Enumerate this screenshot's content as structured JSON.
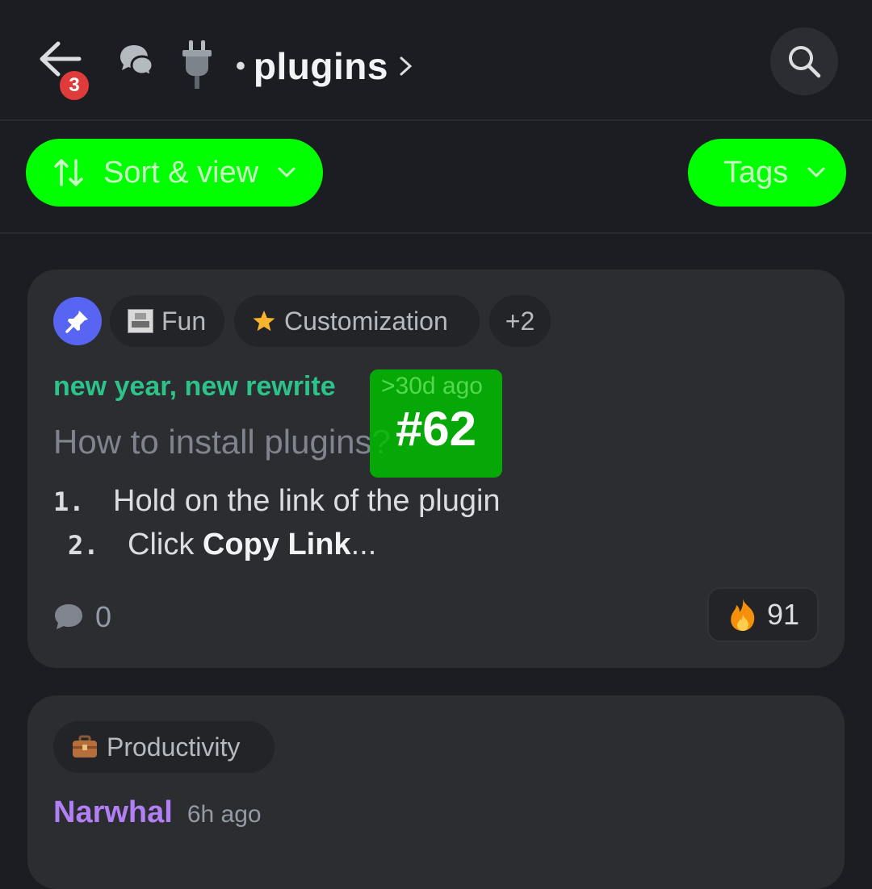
{
  "header": {
    "back_badge_count": "3",
    "channel_separator": "•",
    "channel_name": "plugins",
    "icons": [
      "back-arrow-icon",
      "threads-icon",
      "plug-icon",
      "chevron-right-icon",
      "search-icon"
    ]
  },
  "filters": {
    "sort_label": "Sort & view",
    "tags_label": "Tags",
    "accent_color": "#00ff00"
  },
  "posts": [
    {
      "pinned": true,
      "tags": [
        {
          "label": "Fun",
          "icon": "image-thumbnail"
        },
        {
          "label": "Customization",
          "icon": "star-icon"
        },
        {
          "label": "+2"
        }
      ],
      "author": "new year, new rewrite",
      "time": ">30d ago",
      "overlay_id": "#62",
      "title": "How to install plugins?",
      "steps": [
        {
          "num": "1.",
          "text": "Hold on the link of the plugin"
        },
        {
          "num": "2.",
          "text_pre": "Click ",
          "text_bold": "Copy Link",
          "text_post": "..."
        }
      ],
      "comment_count": "0",
      "reaction": {
        "emoji": "fire",
        "count": "91"
      }
    },
    {
      "tags": [
        {
          "label": "Productivity",
          "icon": "briefcase-icon"
        }
      ],
      "author": "Narwhal",
      "time": "6h ago"
    }
  ]
}
